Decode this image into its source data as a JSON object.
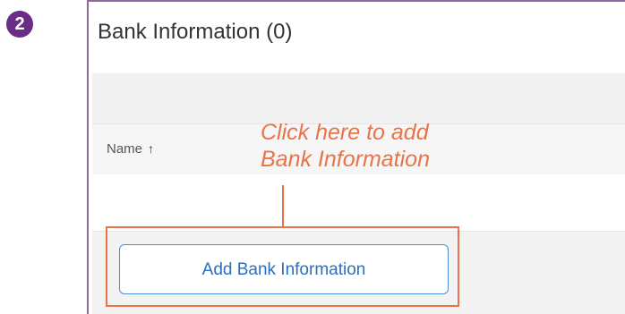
{
  "step_badge": "2",
  "panel": {
    "title": "Bank Information (0)"
  },
  "table": {
    "column_name_label": "Name",
    "sort_indicator": "↑"
  },
  "add_button_label": "Add Bank Information",
  "callout": {
    "line1": "Click here to add",
    "line2": "Bank Information"
  },
  "colors": {
    "panel_border": "#8e6aa0",
    "badge": "#6a2d86",
    "button_border": "#4a8fd8",
    "button_text": "#2a6fc0",
    "annotation": "#e8744a"
  },
  "icons": {
    "sort": "sort-ascending-icon"
  }
}
